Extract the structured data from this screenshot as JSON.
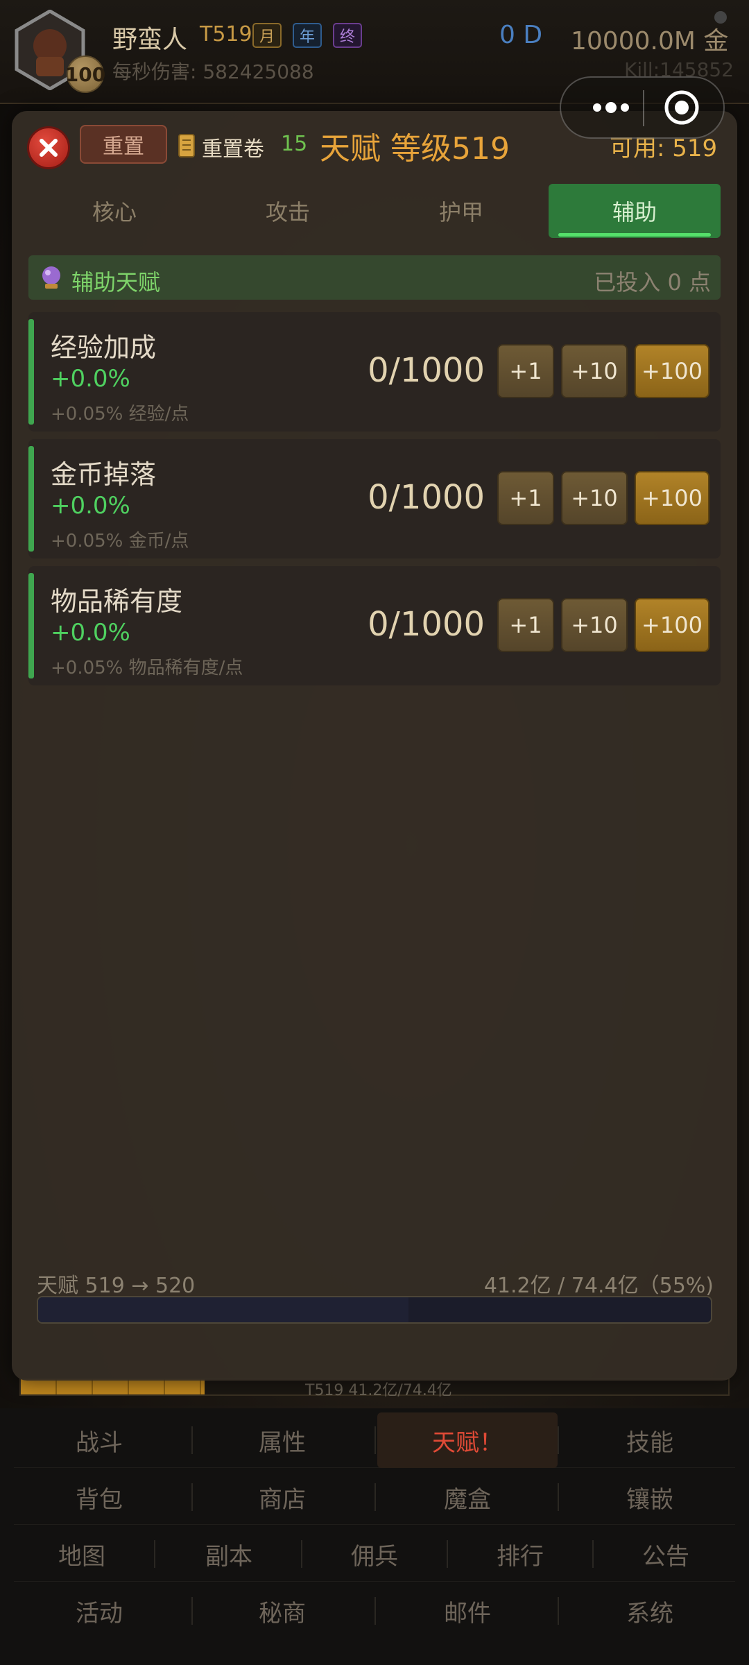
{
  "header": {
    "avatar_level": "100",
    "player_name": "野蛮人",
    "tier": "T519",
    "badges": {
      "month": "月",
      "year": "年",
      "final": "终"
    },
    "dps": "每秒伤害: 582425088",
    "currency_d": "0 D",
    "gold": "10000.0M 金",
    "kills": "Kill:145852"
  },
  "modal": {
    "reset_label": "重置",
    "scroll_label": "重置卷",
    "scroll_count": "15",
    "title": "天赋 等级519",
    "available": "可用: 519",
    "tabs": [
      {
        "label": "核心",
        "active": false
      },
      {
        "label": "攻击",
        "active": false
      },
      {
        "label": "护甲",
        "active": false
      },
      {
        "label": "辅助",
        "active": true
      }
    ],
    "section": {
      "title": "辅助天赋",
      "invested": "已投入 0 点"
    },
    "talents": [
      {
        "name": "经验加成",
        "pct": "+0.0%",
        "desc": "+0.05% 经验/点",
        "progress": "0/1000"
      },
      {
        "name": "金币掉落",
        "pct": "+0.0%",
        "desc": "+0.05% 金币/点",
        "progress": "0/1000"
      },
      {
        "name": "物品稀有度",
        "pct": "+0.0%",
        "desc": "+0.05% 物品稀有度/点",
        "progress": "0/1000"
      }
    ],
    "buttons": {
      "plus1": "+1",
      "plus10": "+10",
      "plus100": "+100"
    },
    "footer": {
      "label": "天赋 519 → 520",
      "exp": "41.2亿 / 74.4亿（55%)",
      "progress_fraction": 0.55
    }
  },
  "game_xp_text": "T519 41.2亿/74.4亿",
  "game_xp_fraction": 0.26,
  "nav": {
    "row1": [
      "战斗",
      "属性",
      "天赋！",
      "技能"
    ],
    "row2": [
      "背包",
      "商店",
      "魔盒",
      "镶嵌"
    ],
    "row3": [
      "地图",
      "副本",
      "佣兵",
      "排行",
      "公告"
    ],
    "row4": [
      "活动",
      "秘商",
      "邮件",
      "系统"
    ]
  },
  "colors": {
    "accent_green": "#4fd160",
    "gold": "#e8a43a",
    "active_tab": "#2d7a3a",
    "close_red": "#e24a3d"
  },
  "icons": [
    "close-icon",
    "scroll-icon",
    "crystal-ball-icon",
    "more-icon",
    "target-icon"
  ]
}
